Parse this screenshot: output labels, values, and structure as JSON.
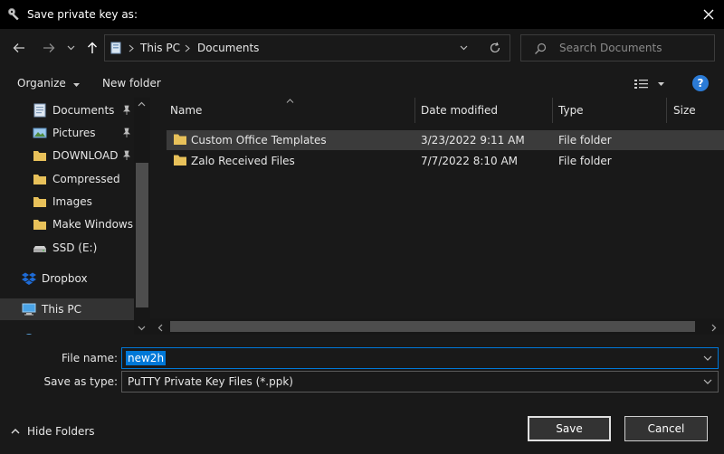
{
  "window": {
    "title": "Save private key as:"
  },
  "address": {
    "crumbs": [
      "This PC",
      "Documents"
    ]
  },
  "search": {
    "placeholder": "Search Documents"
  },
  "toolbar": {
    "organize_label": "Organize",
    "new_folder_label": "New folder",
    "help_label": "?"
  },
  "sidebar": {
    "items": [
      {
        "label": "Documents",
        "icon": "documents-icon",
        "pinned": true
      },
      {
        "label": "Pictures",
        "icon": "pictures-icon",
        "pinned": true
      },
      {
        "label": "DOWNLOAD",
        "icon": "folder-icon",
        "pinned": true
      },
      {
        "label": "Compressed",
        "icon": "folder-icon",
        "pinned": false
      },
      {
        "label": "Images",
        "icon": "folder-icon",
        "pinned": false
      },
      {
        "label": "Make Windows F",
        "icon": "folder-icon",
        "pinned": false
      },
      {
        "label": "SSD (E:)",
        "icon": "drive-icon",
        "pinned": false
      },
      {
        "label": "Dropbox",
        "icon": "dropbox-icon",
        "pinned": false
      },
      {
        "label": "This PC",
        "icon": "pc-icon",
        "pinned": false,
        "selected": true
      }
    ]
  },
  "files": {
    "columns": [
      "Name",
      "Date modified",
      "Type",
      "Size"
    ],
    "rows": [
      {
        "name": "Custom Office Templates",
        "date": "3/23/2022 9:11 AM",
        "type": "File folder",
        "size": ""
      },
      {
        "name": "Zalo Received Files",
        "date": "7/7/2022 8:10 AM",
        "type": "File folder",
        "size": ""
      }
    ]
  },
  "form": {
    "file_name_label": "File name:",
    "file_name_value": "new2h",
    "save_type_label": "Save as type:",
    "save_type_value": "PuTTY Private Key Files (*.ppk)"
  },
  "buttons": {
    "save_label": "Save",
    "cancel_label": "Cancel",
    "hide_folders_label": "Hide Folders"
  },
  "colors": {
    "accent": "#0078d7",
    "background": "#191919",
    "help": "#2b7bd6",
    "folder": "#e8c15a"
  }
}
